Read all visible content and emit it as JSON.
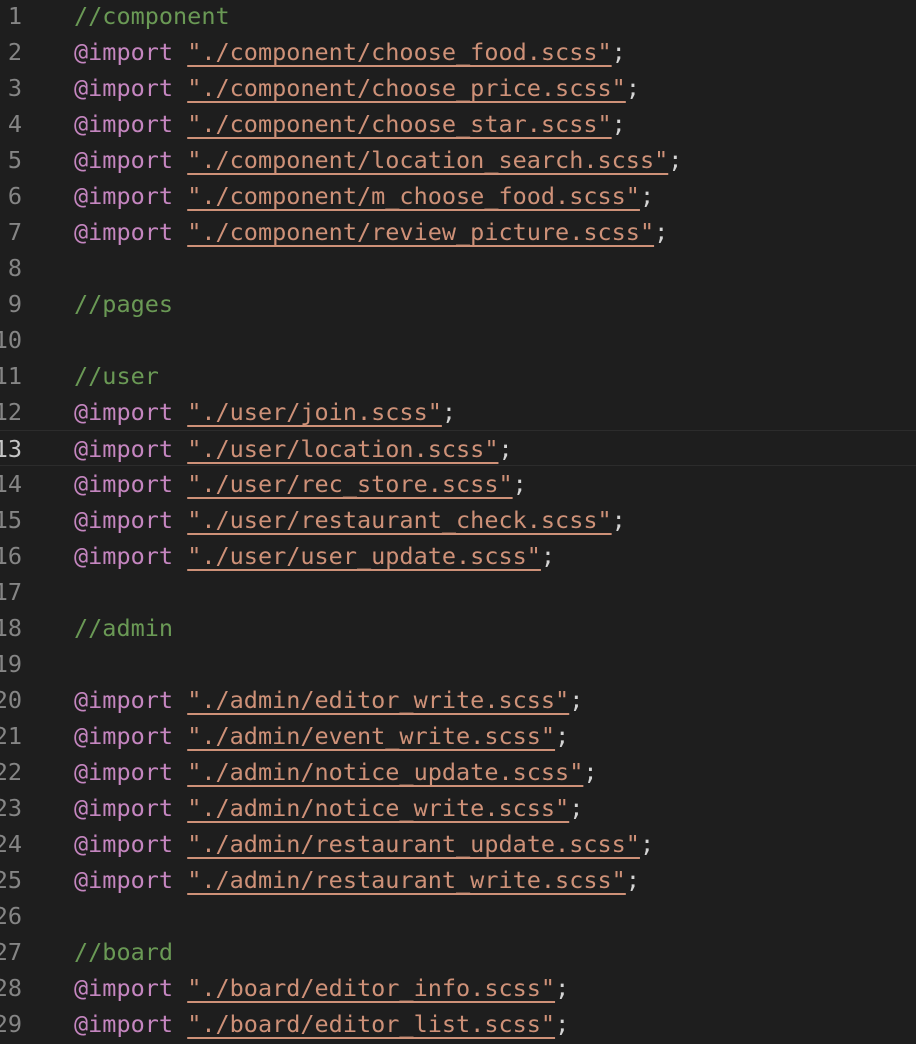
{
  "editor": {
    "current_line": 13,
    "lines": [
      {
        "n": "1",
        "type": "comment",
        "text": "//component"
      },
      {
        "n": "2",
        "type": "import",
        "kw": "@import",
        "str": "\"./component/choose_food.scss\"",
        "end": ";"
      },
      {
        "n": "3",
        "type": "import",
        "kw": "@import",
        "str": "\"./component/choose_price.scss\"",
        "end": ";"
      },
      {
        "n": "4",
        "type": "import",
        "kw": "@import",
        "str": "\"./component/choose_star.scss\"",
        "end": ";"
      },
      {
        "n": "5",
        "type": "import",
        "kw": "@import",
        "str": "\"./component/location_search.scss\"",
        "end": ";"
      },
      {
        "n": "6",
        "type": "import",
        "kw": "@import",
        "str": "\"./component/m_choose_food.scss\"",
        "end": ";"
      },
      {
        "n": "7",
        "type": "import",
        "kw": "@import",
        "str": "\"./component/review_picture.scss\"",
        "end": ";"
      },
      {
        "n": "8",
        "type": "empty"
      },
      {
        "n": "9",
        "type": "comment",
        "text": "//pages"
      },
      {
        "n": "10",
        "type": "empty"
      },
      {
        "n": "11",
        "type": "comment",
        "text": "//user"
      },
      {
        "n": "12",
        "type": "import",
        "kw": "@import",
        "str": "\"./user/join.scss\"",
        "end": ";"
      },
      {
        "n": "13",
        "type": "import",
        "kw": "@import",
        "str": "\"./user/location.scss\"",
        "end": ";"
      },
      {
        "n": "14",
        "type": "import",
        "kw": "@import",
        "str": "\"./user/rec_store.scss\"",
        "end": ";"
      },
      {
        "n": "15",
        "type": "import",
        "kw": "@import",
        "str": "\"./user/restaurant_check.scss\"",
        "end": ";"
      },
      {
        "n": "16",
        "type": "import",
        "kw": "@import",
        "str": "\"./user/user_update.scss\"",
        "end": ";"
      },
      {
        "n": "17",
        "type": "empty"
      },
      {
        "n": "18",
        "type": "comment",
        "text": "//admin"
      },
      {
        "n": "19",
        "type": "empty"
      },
      {
        "n": "20",
        "type": "import",
        "kw": "@import",
        "str": "\"./admin/editor_write.scss\"",
        "end": ";"
      },
      {
        "n": "21",
        "type": "import",
        "kw": "@import",
        "str": "\"./admin/event_write.scss\"",
        "end": ";"
      },
      {
        "n": "22",
        "type": "import",
        "kw": "@import",
        "str": "\"./admin/notice_update.scss\"",
        "end": ";"
      },
      {
        "n": "23",
        "type": "import",
        "kw": "@import",
        "str": "\"./admin/notice_write.scss\"",
        "end": ";"
      },
      {
        "n": "24",
        "type": "import",
        "kw": "@import",
        "str": "\"./admin/restaurant_update.scss\"",
        "end": ";"
      },
      {
        "n": "25",
        "type": "import",
        "kw": "@import",
        "str": "\"./admin/restaurant_write.scss\"",
        "end": ";"
      },
      {
        "n": "26",
        "type": "empty"
      },
      {
        "n": "27",
        "type": "comment",
        "text": "//board"
      },
      {
        "n": "28",
        "type": "import",
        "kw": "@import",
        "str": "\"./board/editor_info.scss\"",
        "end": ";"
      },
      {
        "n": "29",
        "type": "import",
        "kw": "@import",
        "str": "\"./board/editor_list.scss\"",
        "end": ";"
      }
    ]
  }
}
